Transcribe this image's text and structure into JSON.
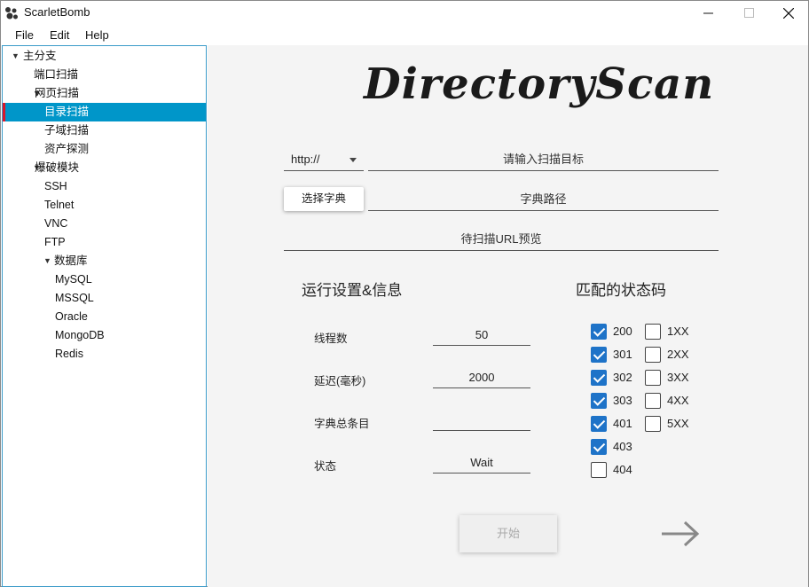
{
  "window": {
    "title": "ScarletBomb"
  },
  "menu": [
    "File",
    "Edit",
    "Help"
  ],
  "tree": [
    {
      "label": "主分支",
      "level": 0,
      "expanded": true
    },
    {
      "label": "端口扫描",
      "level": 1
    },
    {
      "label": "网页扫描",
      "level": 1,
      "expanded": true
    },
    {
      "label": "目录扫描",
      "level": 2,
      "selected": true
    },
    {
      "label": "子域扫描",
      "level": 2
    },
    {
      "label": "资产探测",
      "level": 2
    },
    {
      "label": "爆破模块",
      "level": 1,
      "expanded": true
    },
    {
      "label": "SSH",
      "level": 2
    },
    {
      "label": "Telnet",
      "level": 2
    },
    {
      "label": "VNC",
      "level": 2
    },
    {
      "label": "FTP",
      "level": 2
    },
    {
      "label": "数据库",
      "level": 2,
      "expanded": true
    },
    {
      "label": "MySQL",
      "level": 3
    },
    {
      "label": "MSSQL",
      "level": 3
    },
    {
      "label": "Oracle",
      "level": 3
    },
    {
      "label": "MongoDB",
      "level": 3
    },
    {
      "label": "Redis",
      "level": 3
    }
  ],
  "main": {
    "logo": "DirectoryScan",
    "protocol": "http://",
    "target_placeholder": "请输入扫描目标",
    "dict_button": "选择字典",
    "dict_path_placeholder": "字典路径",
    "preview_placeholder": "待扫描URL预览",
    "settings_title": "运行设置&信息",
    "status_title": "匹配的状态码",
    "fields": [
      {
        "label": "线程数",
        "value": "50"
      },
      {
        "label": "延迟(毫秒)",
        "value": "2000"
      },
      {
        "label": "字典总条目",
        "value": ""
      },
      {
        "label": "状态",
        "value": "Wait"
      }
    ],
    "codes_left": [
      {
        "code": "200",
        "checked": true
      },
      {
        "code": "301",
        "checked": true
      },
      {
        "code": "302",
        "checked": true
      },
      {
        "code": "303",
        "checked": true
      },
      {
        "code": "401",
        "checked": true
      },
      {
        "code": "403",
        "checked": true
      },
      {
        "code": "404",
        "checked": false
      }
    ],
    "codes_right": [
      {
        "code": "1XX",
        "checked": false
      },
      {
        "code": "2XX",
        "checked": false
      },
      {
        "code": "3XX",
        "checked": false
      },
      {
        "code": "4XX",
        "checked": false
      },
      {
        "code": "5XX",
        "checked": false
      }
    ],
    "start_button": "开始",
    "accent_color": "#0096c9",
    "checkbox_color": "#1e73c8"
  }
}
